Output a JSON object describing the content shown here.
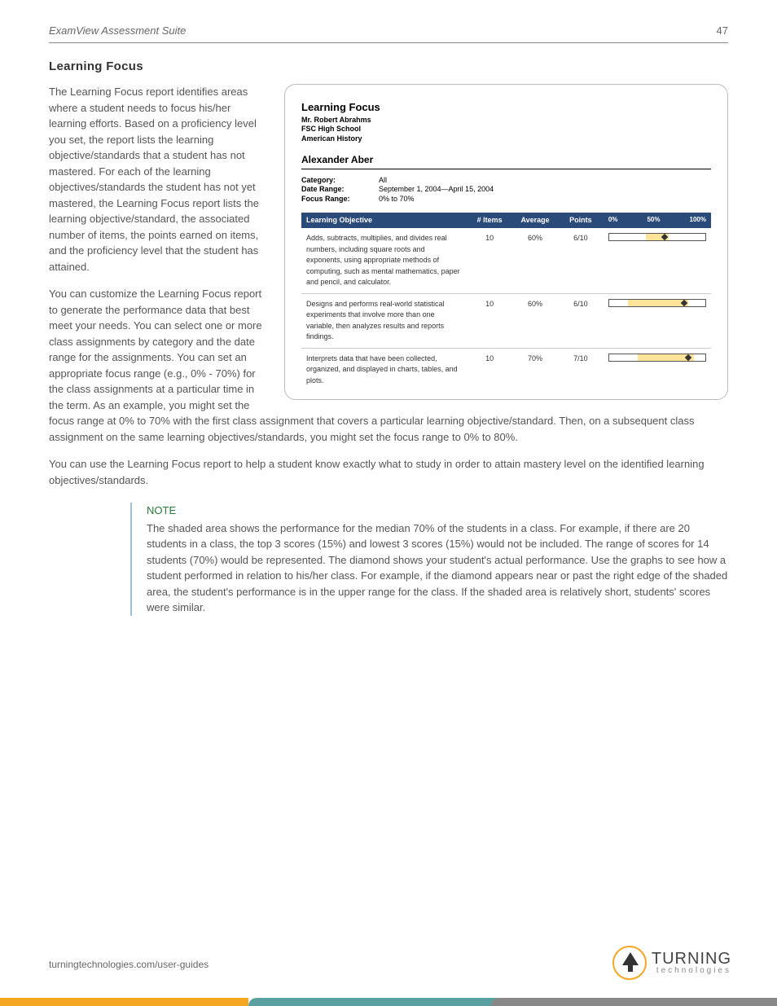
{
  "header": {
    "title": "ExamView Assessment Suite",
    "page_number": "47"
  },
  "section_heading": "Learning Focus",
  "paragraphs": {
    "p1": "The Learning Focus report identifies areas where a student needs to focus his/her learning efforts. Based on a proficiency level you set, the report lists the learning objective/standards that a student has not mastered. For each of the learning objectives/standards the student has not yet mastered, the Learning Focus report lists the learning objective/standard, the associated number of items, the points earned on items, and the proficiency level that the student has attained.",
    "p2": "You can customize the Learning Focus report to generate the performance data that best meet your needs. You can select one or more class assignments by category and the date range for the assignments. You can set an appropriate focus range (e.g., 0% - 70%) for the class assignments at a particular time in the term. As an example, you might set the focus range at 0% to 70% with the first class assignment that covers a particular learning objective/standard. Then, on a subsequent class assignment on the same learning objectives/standards, you might set the focus range to 0% to 80%.",
    "p3": "You can use the Learning Focus report to help a student know exactly what to study in order to attain mastery level on the identified learning objectives/standards."
  },
  "note": {
    "label": "NOTE",
    "body": "The shaded area shows the performance for the median 70% of the students in a class. For example, if there are 20 students in a class, the top 3 scores (15%) and lowest 3 scores (15%) would not be included. The range of scores for 14 students (70%) would be represented. The diamond shows your student's actual performance. Use the graphs to see how a student performed in relation to his/her class. For example, if the diamond appears near or past the right edge of the shaded area, the student's performance is in the upper range for the class. If the shaded area is relatively short, students' scores were similar."
  },
  "report_figure": {
    "title": "Learning Focus",
    "teacher": "Mr. Robert Abrahms",
    "school": "FSC High School",
    "course": "American History",
    "student": "Alexander Aber",
    "meta_labels": {
      "category": "Category:",
      "date_range": "Date Range:",
      "focus_range": "Focus Range:"
    },
    "meta_values": {
      "category": "All",
      "date_range": "September 1, 2004—April 15, 2004",
      "focus_range": "0% to 70%"
    },
    "columns": {
      "objective": "Learning Objective",
      "items": "# Items",
      "average": "Average",
      "points": "Points",
      "scale_0": "0%",
      "scale_50": "50%",
      "scale_100": "100%"
    },
    "rows": [
      {
        "objective": "Adds, subtracts, multiplies, and divides real numbers, including square roots and exponents, using appropriate methods of computing, such as mental mathematics, paper and pencil, and calculator.",
        "items": "10",
        "average": "60%",
        "points": "6/10",
        "bar_start": 38,
        "bar_end": 62,
        "diamond": 58
      },
      {
        "objective": "Designs and performs real-world statistical experiments that involve more than one variable, then analyzes results and reports findings.",
        "items": "10",
        "average": "60%",
        "points": "6/10",
        "bar_start": 20,
        "bar_end": 82,
        "diamond": 78
      },
      {
        "objective": "Interprets data that have been collected, organized, and displayed in charts, tables, and plots.",
        "items": "10",
        "average": "70%",
        "points": "7/10",
        "bar_start": 30,
        "bar_end": 88,
        "diamond": 82
      }
    ]
  },
  "footer": {
    "url": "turningtechnologies.com/user-guides",
    "logo_main": "TURNING",
    "logo_sub": "technologies"
  }
}
